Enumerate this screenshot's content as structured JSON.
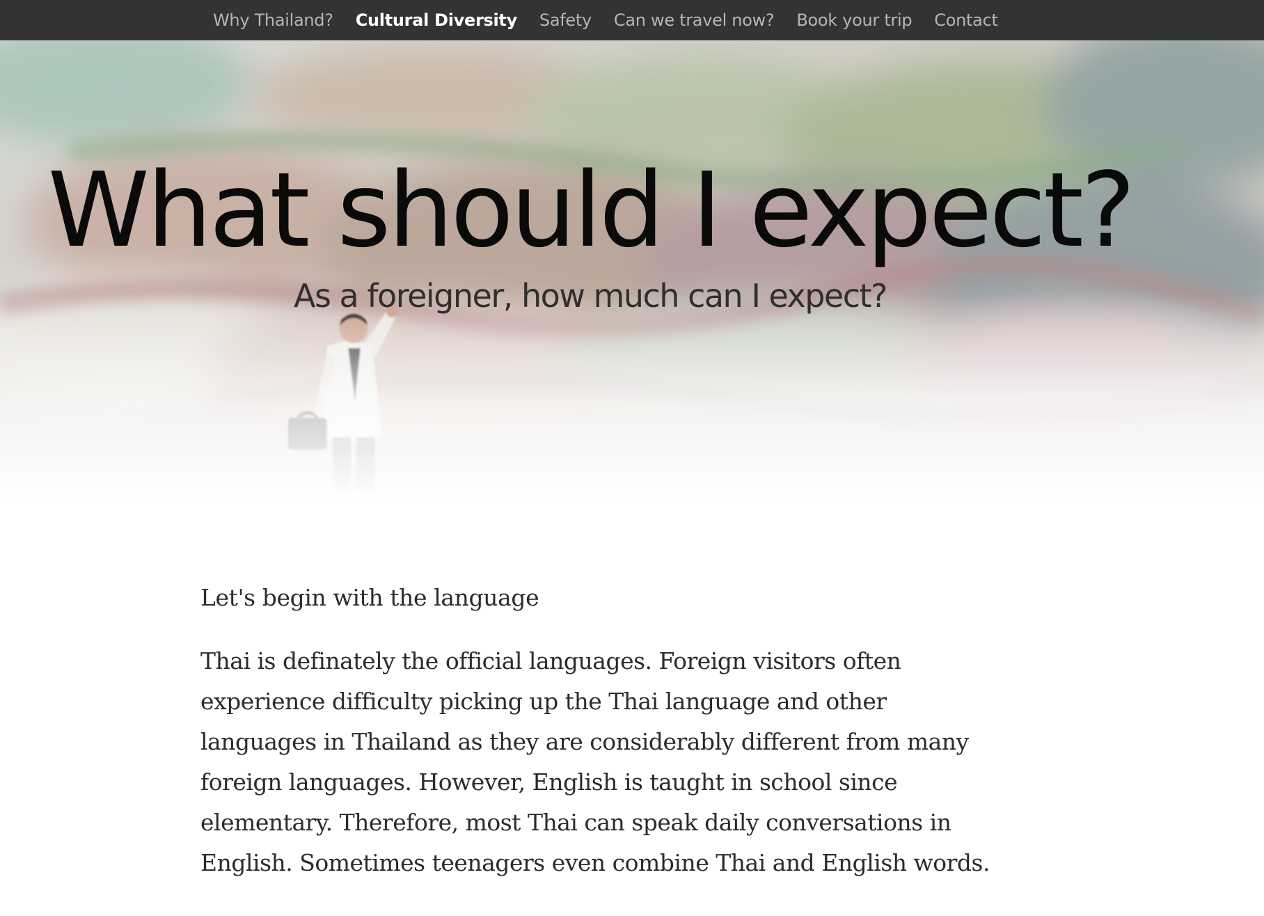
{
  "nav": {
    "items": [
      {
        "label": "Why Thailand?",
        "active": false
      },
      {
        "label": "Cultural Diversity",
        "active": true
      },
      {
        "label": "Safety",
        "active": false
      },
      {
        "label": "Can we travel now?",
        "active": false
      },
      {
        "label": "Book your trip",
        "active": false
      },
      {
        "label": "Contact",
        "active": false
      }
    ]
  },
  "hero": {
    "title": "What should I expect?",
    "subtitle": "As a foreigner, how much can I expect?",
    "background_description_icon": "map-background",
    "figure_icon": "traveler-figurine-icon"
  },
  "content": {
    "heading": "Let's begin with the language",
    "paragraph": "Thai is definately the official languages. Foreign visitors often experience difficulty picking up the Thai language and other languages in Thailand as they are considerably different from many foreign languages. However, English is taught in school since elementary. Therefore, most Thai can speak daily conversations in English. Sometimes teenagers even combine Thai and English words."
  },
  "colors": {
    "navbar_bg": "#333333",
    "nav_text": "#b5b5b5",
    "nav_active": "#ffffff",
    "body_text": "#2b2b2b",
    "title_text": "#0a0a0a"
  }
}
